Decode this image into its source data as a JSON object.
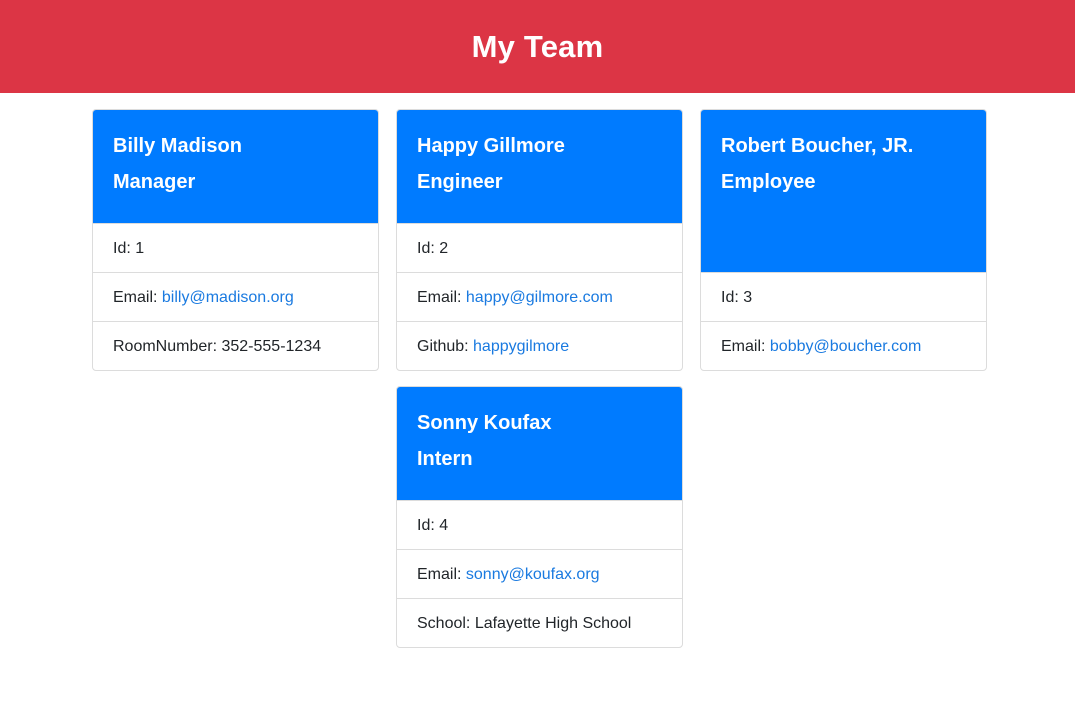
{
  "header": {
    "title": "My Team"
  },
  "cards": [
    {
      "name": "Billy Madison",
      "role": "Manager",
      "id_label": "Id: 1",
      "email_label": "Email: ",
      "email": "billy@madison.org",
      "extra_label": "RoomNumber: 352-555-1234"
    },
    {
      "name": "Happy Gillmore",
      "role": "Engineer",
      "id_label": "Id: 2",
      "email_label": "Email: ",
      "email": "happy@gilmore.com",
      "extra_label": "Github: ",
      "github": "happygilmore"
    },
    {
      "name": "Robert Boucher, JR.",
      "role": "Employee",
      "id_label": "Id: 3",
      "email_label": "Email: ",
      "email": "bobby@boucher.com"
    },
    {
      "name": "Sonny Koufax",
      "role": "Intern",
      "id_label": "Id: 4",
      "email_label": "Email: ",
      "email": "sonny@koufax.org",
      "extra_label": "School: Lafayette High School"
    }
  ],
  "colors": {
    "header_bg": "#dc3545",
    "card_head_bg": "#007bff",
    "link": "#1a7ae0"
  }
}
